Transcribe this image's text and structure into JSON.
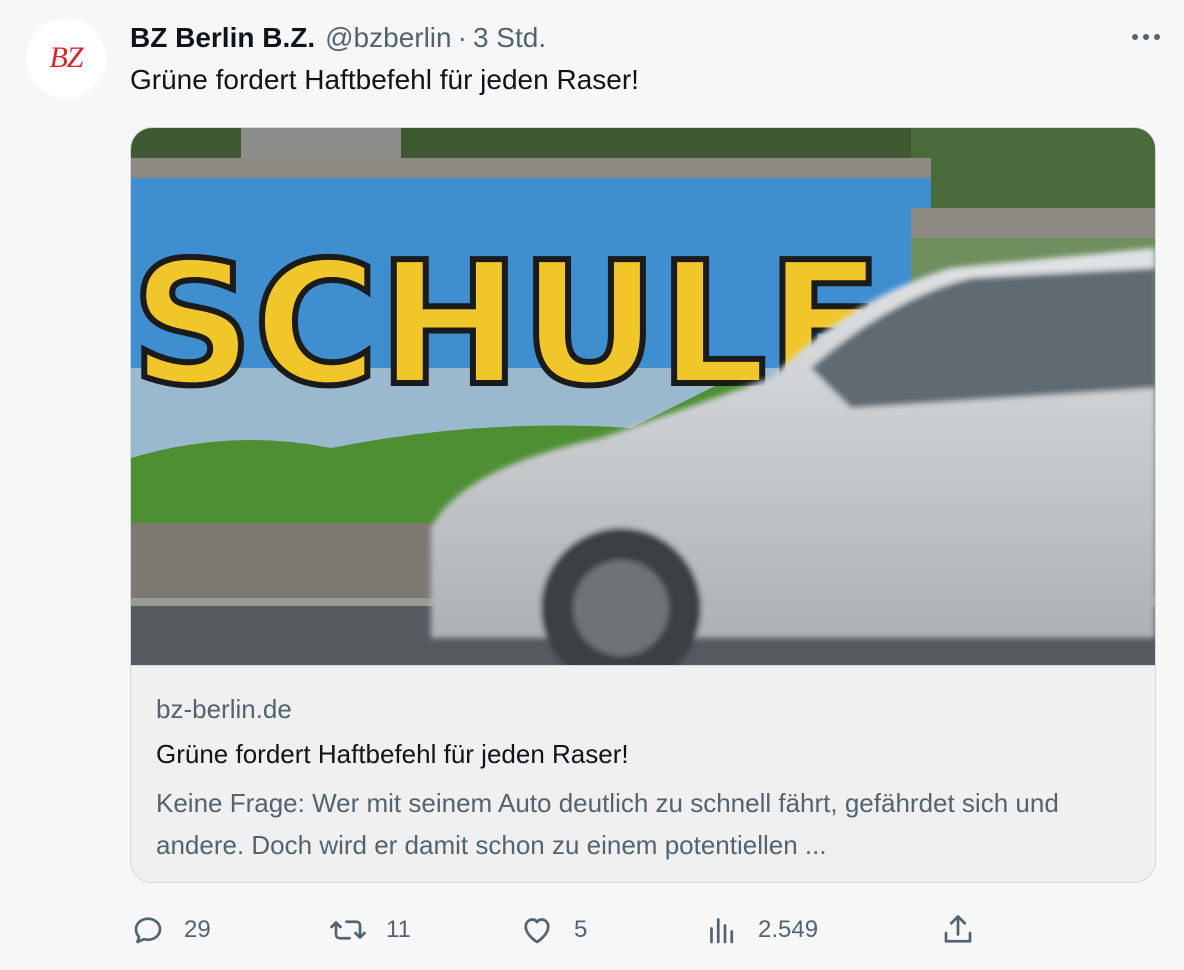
{
  "author": {
    "avatar_logo": "BZ",
    "name": "BZ Berlin B.Z.",
    "handle": "@bzberlin",
    "separator": "·",
    "time": "3 Std."
  },
  "tweet": {
    "text": "Grüne fordert Haftbefehl für jeden Raser!"
  },
  "card": {
    "image_text": "SCHULE",
    "domain": "bz-berlin.de",
    "title": "Grüne fordert Haftbefehl für jeden Raser!",
    "description": "Keine Frage: Wer mit seinem Auto deutlich zu schnell fährt, gefährdet sich und andere. Doch wird er damit schon zu einem potentiellen ..."
  },
  "actions": {
    "replies": "29",
    "retweets": "11",
    "likes": "5",
    "views": "2.549"
  },
  "icons": {
    "reply": "reply-icon",
    "retweet": "retweet-icon",
    "like": "heart-icon",
    "views": "views-chart-icon",
    "share": "share-icon",
    "more": "more-dots-icon"
  },
  "colors": {
    "text_primary": "#0f1419",
    "text_secondary": "#536471",
    "border": "#cfd9de",
    "brand_red": "#d6262b"
  }
}
